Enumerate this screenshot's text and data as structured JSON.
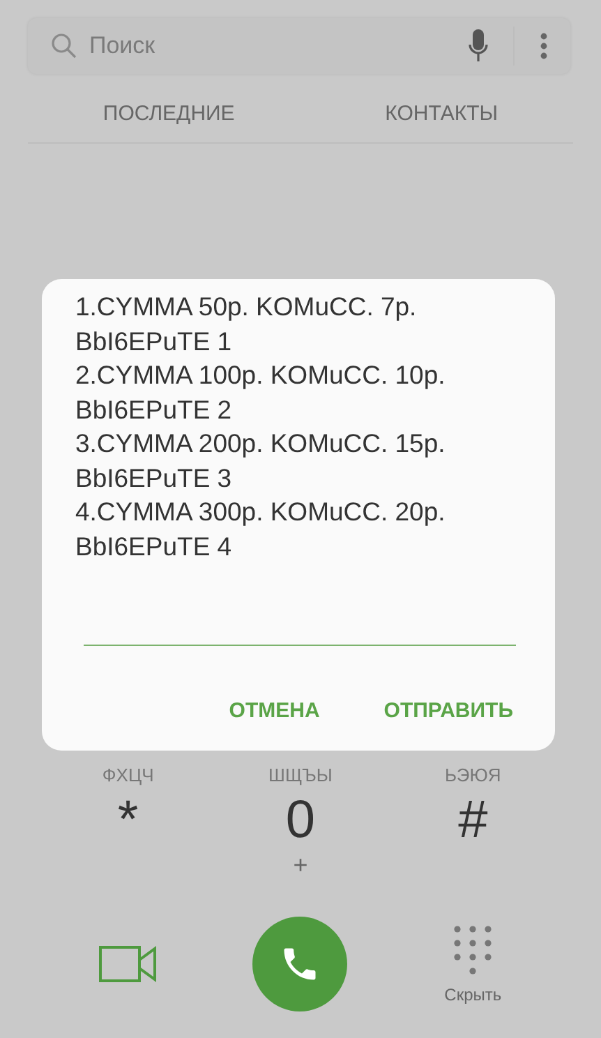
{
  "search": {
    "placeholder": "Поиск"
  },
  "tabs": [
    {
      "label": "ПОСЛЕДНИЕ",
      "selected": false
    },
    {
      "label": "КОНТАКТЫ",
      "selected": false
    }
  ],
  "keypad": [
    {
      "letters": "ФХЦЧ",
      "key": "*"
    },
    {
      "letters": "ШЩЪЫ",
      "key": "0",
      "sub": "+"
    },
    {
      "letters": "ЬЭЮЯ",
      "key": "#"
    }
  ],
  "actions": {
    "hide_label": "Скрыть"
  },
  "dialog": {
    "lines": [
      "1.CYMMA 50р. KOMuCC. 7р.",
      "BbI6EPuTE 1",
      "2.CYMMA 100р. KOMuCC. 10р.",
      "BbI6EPuTE 2",
      "3.CYMMA 200р. KOMuCC. 15р.",
      "BbI6EPuTE 3",
      "4.CYMMA 300р. KOMuCC. 20р.",
      "BbI6EPuTE 4"
    ],
    "buttons": [
      "ОТМЕНА",
      "ОТПРАВИТЬ"
    ]
  }
}
